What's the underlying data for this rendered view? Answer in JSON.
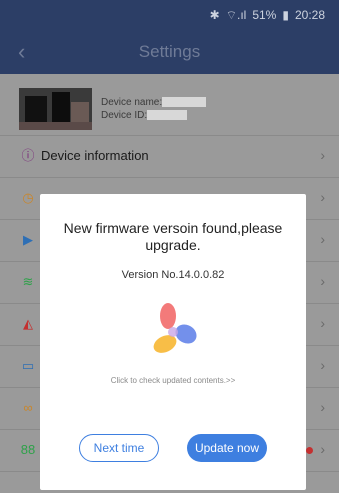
{
  "statusbar": {
    "bluetooth": "✱",
    "signal": "⌔.ıl",
    "battery": "51%",
    "battery_icon": "▮",
    "time": "20:28"
  },
  "titlebar": {
    "title": "Settings",
    "back": "‹"
  },
  "device": {
    "name_label": "Device name:",
    "id_label": "Device ID:"
  },
  "menu": {
    "items": [
      {
        "label": "Device information",
        "icon": "info-icon",
        "glyph": "ⓘ",
        "color": "#7a2a7a"
      },
      {
        "label": "",
        "icon": "clock-icon",
        "glyph": "◷",
        "color": "#c9862b"
      },
      {
        "label": "",
        "icon": "play-icon",
        "glyph": "▶",
        "color": "#2e6fb5"
      },
      {
        "label": "",
        "icon": "wifi-icon",
        "glyph": "≋",
        "color": "#2fa14a"
      },
      {
        "label": "",
        "icon": "alarm-icon",
        "glyph": "◭",
        "color": "#c43030"
      },
      {
        "label": "",
        "icon": "camera-icon",
        "glyph": "▭",
        "color": "#2e6fb5"
      },
      {
        "label": "",
        "icon": "link-icon",
        "glyph": "∞",
        "color": "#c9862b"
      },
      {
        "label": "",
        "icon": "grid-icon",
        "glyph": "88",
        "color": "#2fa14a"
      }
    ],
    "chevron": "›"
  },
  "dialog": {
    "title": "New firmware versoin found,please upgrade.",
    "version": "Version No.14.0.0.82",
    "link": "Click to check updated contents.>>",
    "next_label": "Next time",
    "update_label": "Update now"
  }
}
